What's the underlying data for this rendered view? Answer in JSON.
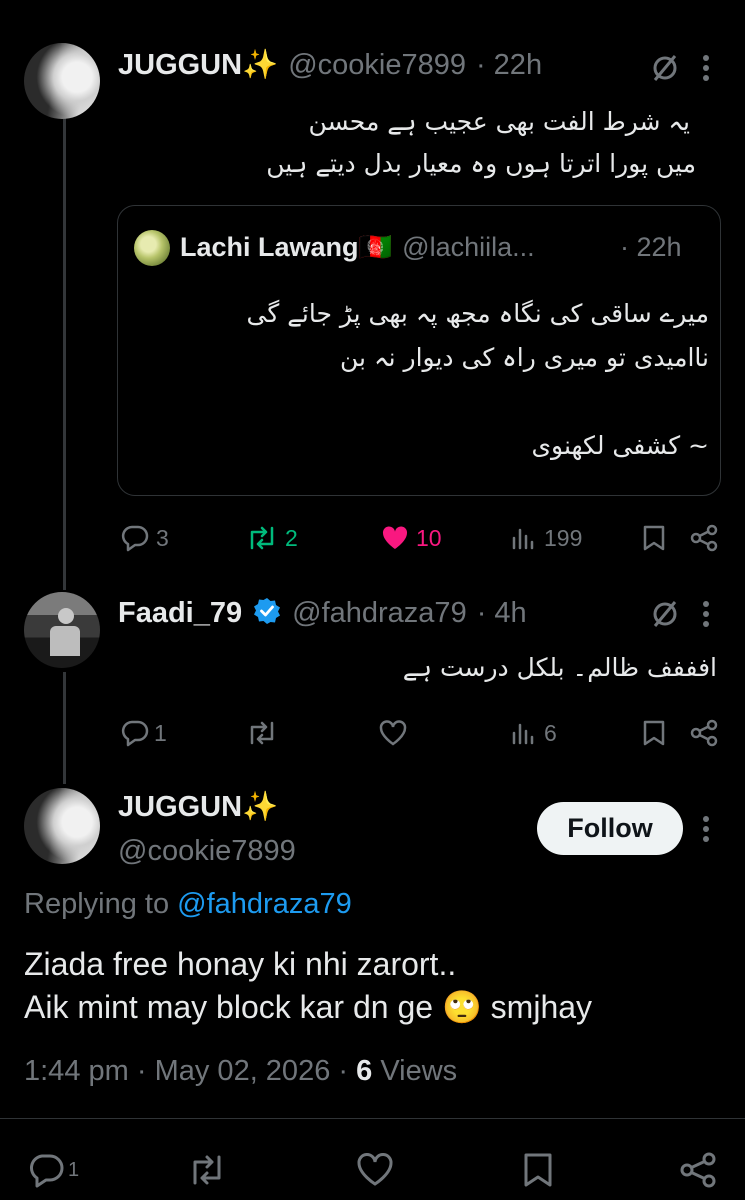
{
  "post1": {
    "name": "JUGGUN✨",
    "handle": "@cookie7899",
    "time": "· 22h",
    "lines": [
      "یہ شرط الفت بھی عجیب ہے محسن",
      "میں پورا اترتا ہوں وہ معیار بدل دیتے ہیں"
    ],
    "quote": {
      "name": "Lachi Lawang🇦🇫",
      "handle": "@lachiila...",
      "time": "· 22h",
      "lines": [
        "میرے ساقی کی نگاہ مجھ پہ بھی پڑ جائے گی",
        "ناامیدی تو میری راہ کی دیوار نہ بن",
        "",
        "~ کشفی لکھنوی"
      ]
    },
    "stats": {
      "replies": "3",
      "reposts": "2",
      "likes": "10",
      "views": "199"
    }
  },
  "post2": {
    "name": "Faadi_79",
    "handle": "@fahdraza79",
    "time": "· 4h",
    "text": "افففف ظالم۔ بلکل درست ہے",
    "stats": {
      "replies": "1",
      "views": "6"
    }
  },
  "main": {
    "name": "JUGGUN✨",
    "handle": "@cookie7899",
    "follow_label": "Follow",
    "replying_prefix": "Replying to",
    "replying_handle": "@fahdraza79",
    "text_line1": "Ziada free honay ki nhi zarort..",
    "text_line2a": "Aik mint may block kar dn ge",
    "emoji": "🙄",
    "text_line2b": "smjhay",
    "meta_time": "1:44 pm",
    "meta_date": "May 02, 2026",
    "meta_views_count": "6",
    "meta_views_label": "Views",
    "stats": {
      "replies": "1"
    }
  },
  "colors": {
    "background": "#000000",
    "text": "#e7e9ea",
    "muted": "#71767b",
    "link": "#1d9bf0",
    "repost": "#00ba7c",
    "like": "#f91880",
    "verified": "#1d9bf0"
  }
}
